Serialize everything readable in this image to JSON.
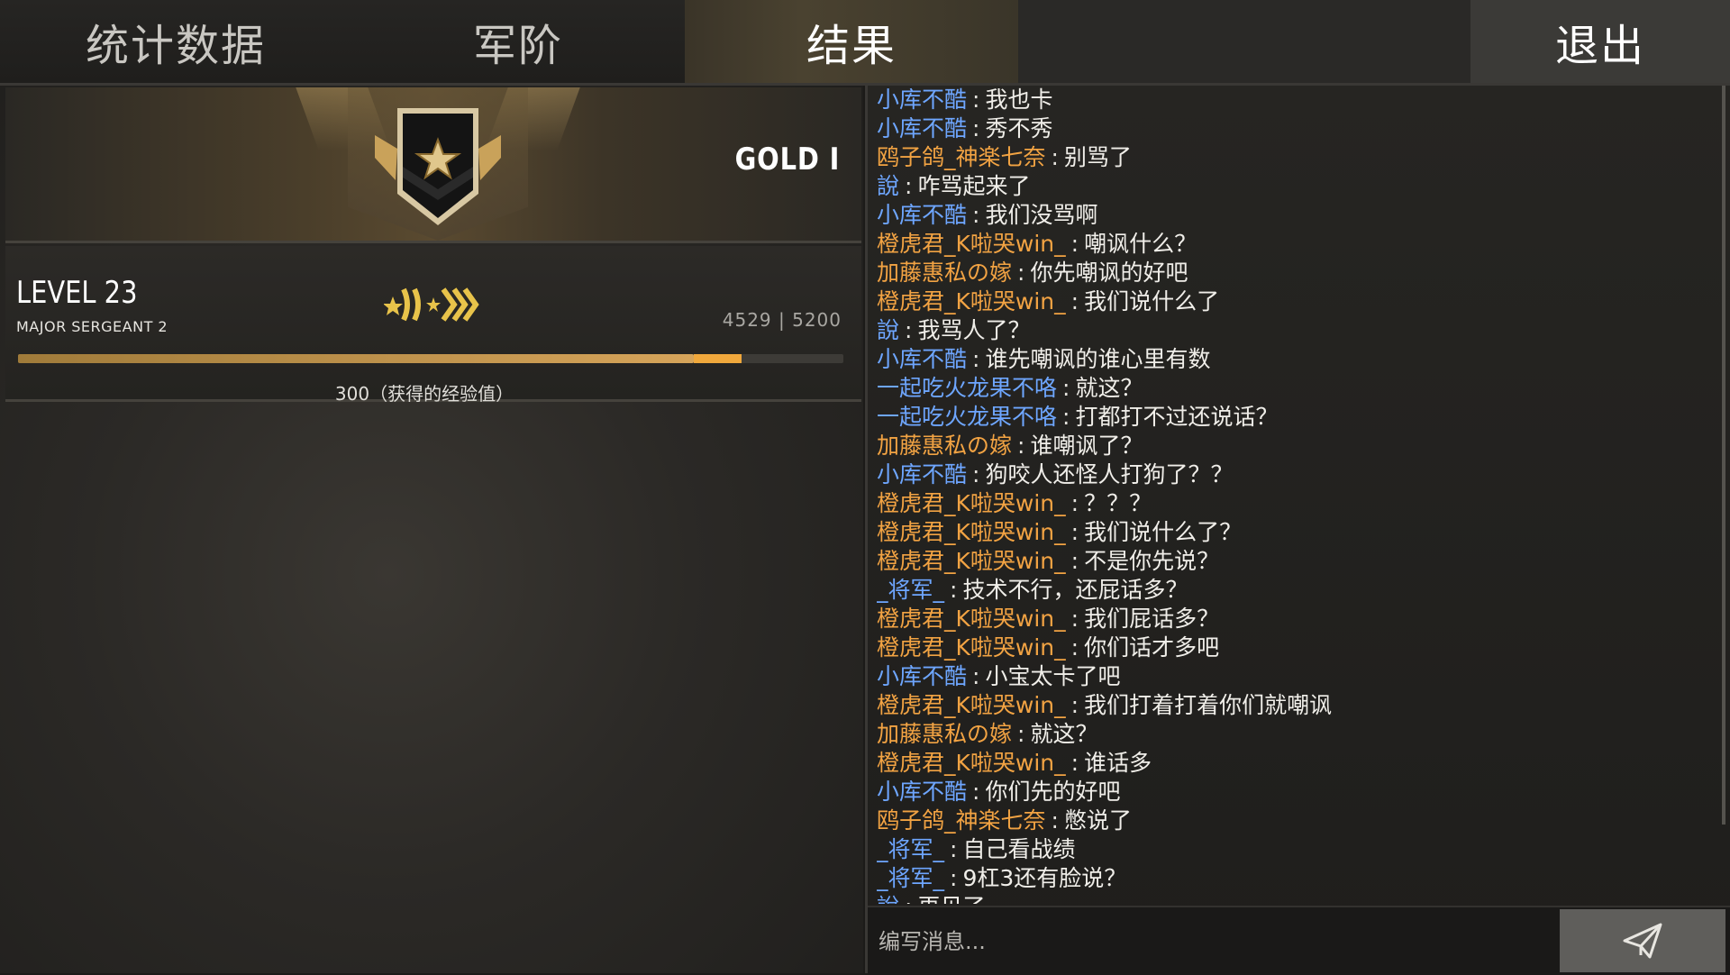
{
  "tabs": {
    "stats": "统计数据",
    "rank": "军阶",
    "result": "结果",
    "exit": "退出"
  },
  "rank": {
    "label": "GOLD I",
    "level": "LEVEL 23",
    "title": "MAJOR SERGEANT 2",
    "xp": "4529 | 5200",
    "xp_progress": 0.871,
    "xp_gain_progress": 0.058,
    "xp_gained": "300（获得的经验值）"
  },
  "chat": {
    "messages": [
      {
        "name": "小库不酷",
        "color": "blue",
        "text": "我也卡"
      },
      {
        "name": "小库不酷",
        "color": "blue",
        "text": "秀不秀"
      },
      {
        "name": "鸥子鸽_神楽七奈",
        "color": "orange",
        "text": "别骂了"
      },
      {
        "name": "說",
        "color": "blue",
        "text": "咋骂起来了"
      },
      {
        "name": "小库不酷",
        "color": "blue",
        "text": "我们没骂啊"
      },
      {
        "name": "橙虎君_K啦哭win_",
        "color": "orange",
        "text": "嘲讽什么？"
      },
      {
        "name": "加藤惠私の嫁",
        "color": "orange",
        "text": "你先嘲讽的好吧"
      },
      {
        "name": "橙虎君_K啦哭win_",
        "color": "orange",
        "text": "我们说什么了"
      },
      {
        "name": "說",
        "color": "blue",
        "text": "我骂人了？"
      },
      {
        "name": "小库不酷",
        "color": "blue",
        "text": "谁先嘲讽的谁心里有数"
      },
      {
        "name": "一起吃火龙果不咯",
        "color": "blue",
        "text": "就这？"
      },
      {
        "name": "一起吃火龙果不咯",
        "color": "blue",
        "text": "打都打不过还说话？"
      },
      {
        "name": "加藤惠私の嫁",
        "color": "orange",
        "text": "谁嘲讽了？"
      },
      {
        "name": "小库不酷",
        "color": "blue",
        "text": "狗咬人还怪人打狗了？？"
      },
      {
        "name": "橙虎君_K啦哭win_",
        "color": "orange",
        "text": "？？？"
      },
      {
        "name": "橙虎君_K啦哭win_",
        "color": "orange",
        "text": "我们说什么了？"
      },
      {
        "name": "橙虎君_K啦哭win_",
        "color": "orange",
        "text": "不是你先说？"
      },
      {
        "name": "_将军_",
        "color": "blue",
        "text": "技术不行，还屁话多？"
      },
      {
        "name": "橙虎君_K啦哭win_",
        "color": "orange",
        "text": "我们屁话多？"
      },
      {
        "name": "橙虎君_K啦哭win_",
        "color": "orange",
        "text": "你们话才多吧"
      },
      {
        "name": "小库不酷",
        "color": "blue",
        "text": "小宝太卡了吧"
      },
      {
        "name": "橙虎君_K啦哭win_",
        "color": "orange",
        "text": "我们打着打着你们就嘲讽"
      },
      {
        "name": "加藤惠私の嫁",
        "color": "orange",
        "text": "就这？"
      },
      {
        "name": "橙虎君_K啦哭win_",
        "color": "orange",
        "text": "谁话多"
      },
      {
        "name": "小库不酷",
        "color": "blue",
        "text": "你们先的好吧"
      },
      {
        "name": "鸥子鸽_神楽七奈",
        "color": "orange",
        "text": "憋说了"
      },
      {
        "name": "_将军_",
        "color": "blue",
        "text": "自己看战绩"
      },
      {
        "name": "_将军_",
        "color": "blue",
        "text": "9杠3还有脸说？"
      },
      {
        "name": "說",
        "color": "blue",
        "text": "再见了"
      }
    ],
    "separator": ":",
    "placeholder": "编写消息..."
  },
  "colors": {
    "blue_team": "#6ea6ff",
    "orange_team": "#f2a343",
    "xp_bar": "#d6a45a",
    "xp_gain": "#f0a83c"
  },
  "icons": {
    "rank_emblem": "gold-shield-star-icon",
    "rank_chevrons": "rank-chevrons-icon",
    "send": "paper-plane-icon"
  }
}
